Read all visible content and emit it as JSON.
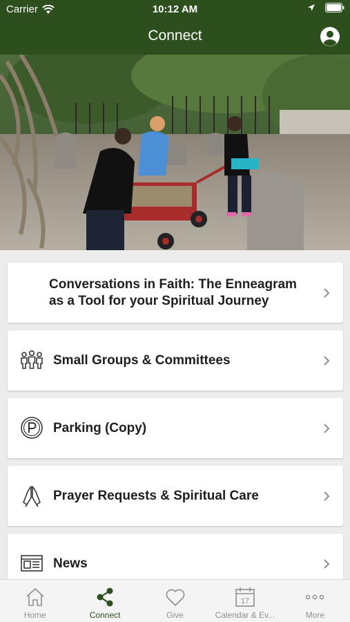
{
  "status_bar": {
    "carrier": "Carrier",
    "time": "10:12 AM"
  },
  "nav": {
    "title": "Connect"
  },
  "hero": {
    "description": "Volunteers clearing stones in a churchyard"
  },
  "items": [
    {
      "label": "Conversations in Faith:  The Enneagram as a Tool for your Spiritual Journey",
      "icon": "none"
    },
    {
      "label": "Small Groups & Committees",
      "icon": "people-group-icon"
    },
    {
      "label": "Parking (Copy)",
      "icon": "parking-icon"
    },
    {
      "label": "Prayer Requests & Spiritual Care",
      "icon": "praying-hands-icon"
    },
    {
      "label": "News",
      "icon": "newspaper-icon"
    }
  ],
  "tabs": [
    {
      "label": "Home",
      "icon": "home-icon"
    },
    {
      "label": "Connect",
      "icon": "share-icon"
    },
    {
      "label": "Give",
      "icon": "heart-icon"
    },
    {
      "label": "Calendar & Ev...",
      "icon": "calendar-icon",
      "calendar_day": "17"
    },
    {
      "label": "More",
      "icon": "more-icon"
    }
  ],
  "colors": {
    "header": "#2d4f1d",
    "active_tab": "#2d4f1d",
    "inactive_tab": "#8e8e8e"
  }
}
